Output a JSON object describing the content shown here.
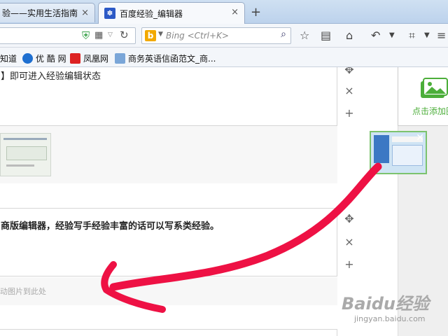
{
  "tabs": [
    {
      "label": "验——实用生活指南",
      "close": "×"
    },
    {
      "label": "百度经验_编辑器",
      "close": "×"
    }
  ],
  "newtab_label": "+",
  "search": {
    "placeholder": "Bing <Ctrl+K>"
  },
  "bookmarks": [
    {
      "label": "知道"
    },
    {
      "label": "优 酷 网"
    },
    {
      "label": "凤凰网"
    },
    {
      "label": "商务英语信函范文_商..."
    }
  ],
  "editor": {
    "step1_text": "】即可进入经验编辑状态",
    "step2_text": "商版编辑器，经验写手经验丰富的话可以写系类经验。",
    "drop_hint": "动图片到此处"
  },
  "controls": {
    "move": "✥",
    "delete": "×",
    "add": "+"
  },
  "sidebar": {
    "add_label": "点击添加图"
  },
  "watermark": {
    "brand": "Baidu经验",
    "url": "jingyan.baidu.com"
  },
  "colors": {
    "accent_green": "#4cae3a",
    "arrow_red": "#ee1144",
    "tab_bg": "#cfe0f2"
  }
}
